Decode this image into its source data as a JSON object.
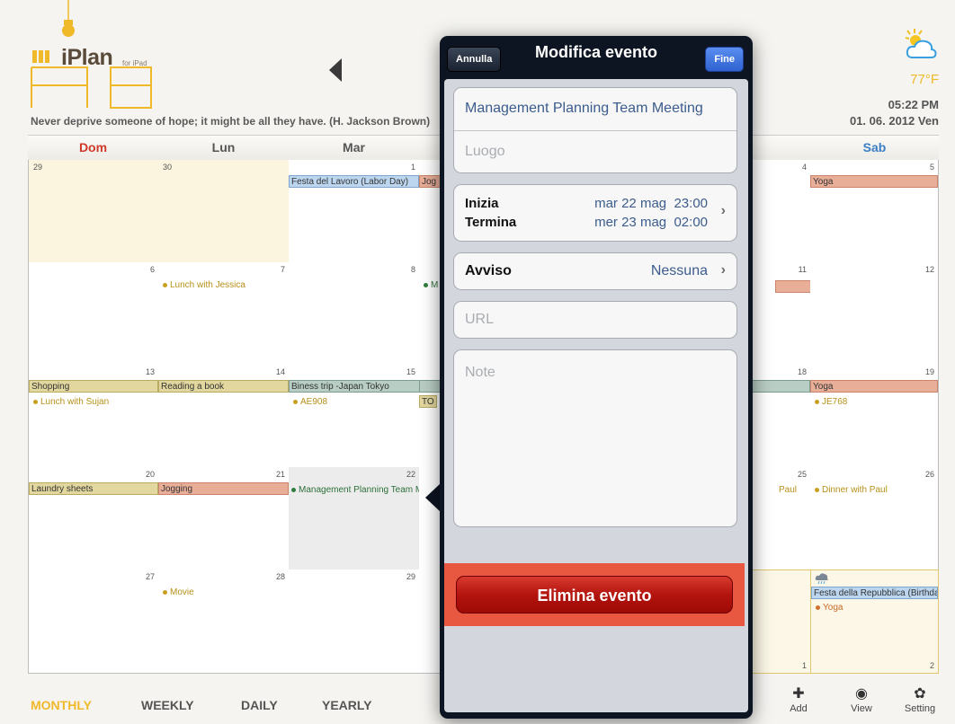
{
  "app": {
    "name": "iPlan",
    "subtitle": "for iPad",
    "quote": "Never deprive someone of hope; it might be all they have. (H. Jackson Brown)",
    "temperature": "77°F",
    "time": "05:22 PM",
    "date": "01. 06. 2012 Ven"
  },
  "calendar": {
    "weekdays": [
      "Dom",
      "Lun",
      "Mar",
      "",
      "",
      "",
      "Sab"
    ],
    "weeks": [
      {
        "days": [
          "29",
          "30",
          "1",
          "",
          "",
          "4",
          "5"
        ]
      },
      {
        "days": [
          "6",
          "7",
          "8",
          "",
          "",
          "11",
          "12"
        ]
      },
      {
        "days": [
          "13",
          "14",
          "15",
          "",
          "",
          "18",
          "19"
        ]
      },
      {
        "days": [
          "20",
          "21",
          "22",
          "",
          "",
          "25",
          "26"
        ]
      },
      {
        "days": [
          "27",
          "28",
          "29",
          "",
          "",
          "",
          "1",
          "2"
        ]
      }
    ],
    "events": {
      "festa_lavoro": "Festa del Lavoro (Labor Day)",
      "jog_cut": "Jog",
      "yoga": "Yoga",
      "lunch_jessica": "Lunch with Jessica",
      "m_cut": "M",
      "shopping": "Shopping",
      "reading": "Reading a book",
      "biness": "Biness trip -Japan Tokyo",
      "lunch_sujan": "Lunch with Sujan",
      "ae908": "AE908",
      "to_cut": "TO",
      "yoga2": "Yoga",
      "je768": "JE768",
      "laundry": "Laundry sheets",
      "jogging": "Jogging",
      "management": "Management Planning Team Meeting",
      "paul_cut": "Paul",
      "dinner_paul": "Dinner with Paul",
      "movie": "Movie",
      "festa_repubblica": "Festa della Repubblica (Birthday)",
      "yoga3": "Yoga"
    }
  },
  "toolbar": {
    "tabs": [
      "MONTHLY",
      "WEEKLY",
      "DAILY",
      "YEARLY"
    ],
    "active_tab": "MONTHLY",
    "add": "Add",
    "view": "View",
    "setting": "Setting"
  },
  "popover": {
    "title": "Modifica evento",
    "cancel": "Annulla",
    "done": "Fine",
    "event_title": "Management Planning Team Meeting",
    "location_placeholder": "Luogo",
    "start_label": "Inizia",
    "end_label": "Termina",
    "start_value": "mar 22 mag  23:00",
    "end_value": "mer 23 mag  02:00",
    "alert_label": "Avviso",
    "alert_value": "Nessuna",
    "url_placeholder": "URL",
    "notes_placeholder": "Note",
    "delete_label": "Elimina evento"
  },
  "colors": {
    "accent_yellow": "#f0b92a",
    "sunday_red": "#d13a2a",
    "saturday_blue": "#3b7fc4",
    "delete_red": "#b3140e"
  }
}
